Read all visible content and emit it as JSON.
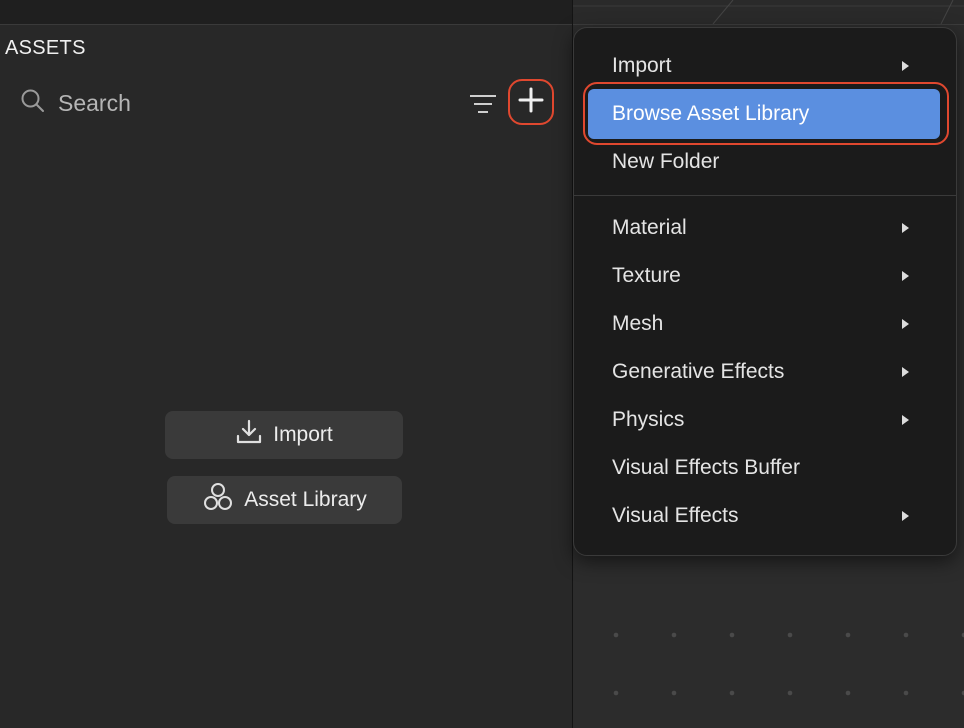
{
  "panel": {
    "title": "ASSETS",
    "search_placeholder": "Search",
    "import_label": "Import",
    "asset_library_label": "Asset Library"
  },
  "menu": {
    "items": [
      {
        "label": "Import",
        "submenu": true
      },
      {
        "label": "Browse Asset Library",
        "submenu": false,
        "highlighted": true
      },
      {
        "label": "New Folder",
        "submenu": false
      },
      {
        "label": "Material",
        "submenu": true
      },
      {
        "label": "Texture",
        "submenu": true
      },
      {
        "label": "Mesh",
        "submenu": true
      },
      {
        "label": "Generative Effects",
        "submenu": true
      },
      {
        "label": "Physics",
        "submenu": true
      },
      {
        "label": "Visual Effects Buffer",
        "submenu": false
      },
      {
        "label": "Visual Effects",
        "submenu": true
      }
    ]
  },
  "colors": {
    "highlight": "#5b8fe0",
    "annotation_ring": "#e0482f",
    "panel_bg": "#282828",
    "menu_bg": "#1b1b1b"
  },
  "icons": [
    "search-icon",
    "filter-icon",
    "plus-icon",
    "download-icon",
    "hexagons-icon",
    "submenu-arrow-icon"
  ]
}
